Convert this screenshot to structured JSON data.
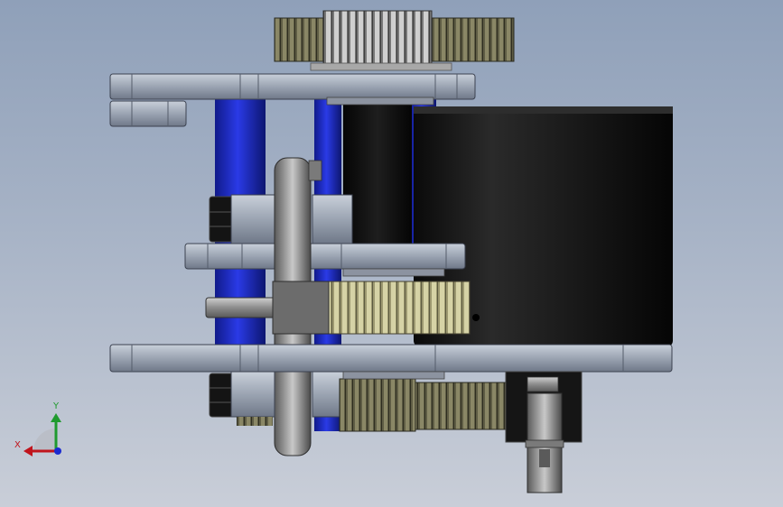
{
  "viewport": {
    "background_top": "#8fa0b9",
    "background_bottom": "#c9ced8"
  },
  "triad": {
    "x_label": "X",
    "y_label": "Y",
    "x_color": "#c0141c",
    "y_color": "#1f9a2e",
    "z_color": "#1a2ad0"
  },
  "colors": {
    "plate": "#9aa3b1",
    "standoff": "#1c28c8",
    "motor_body": "#141414",
    "gear_dark": "#6e6c52",
    "gear_light": "#b8b48a",
    "pulley": "#8a8a8a"
  }
}
